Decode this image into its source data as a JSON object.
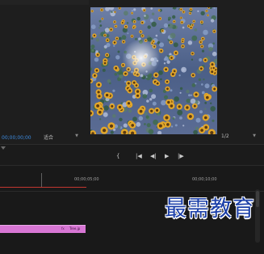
{
  "program_monitor": {
    "title": "",
    "timecode": "00;00;00;00",
    "fit_select": "适合",
    "resolution_select": "1/2"
  },
  "top_tabs": [
    "",
    ""
  ],
  "transport": {
    "mark_in": "{",
    "go_to_in": "|◀",
    "step_back": "◀|",
    "play": "▶",
    "step_forward": "|▶",
    "go_to_out": "▶|"
  },
  "timeline": {
    "ruler_labels": [
      "00;00;05;00",
      "00;00;10;00"
    ],
    "clip": {
      "fx_label": "fx",
      "name": "Tree.jp"
    }
  },
  "watermark": "最需教育",
  "colors": {
    "timecode": "#3d8be0",
    "clip": "#d776d4",
    "work_area": "#c2372f",
    "watermark": "#1a3ea8"
  }
}
